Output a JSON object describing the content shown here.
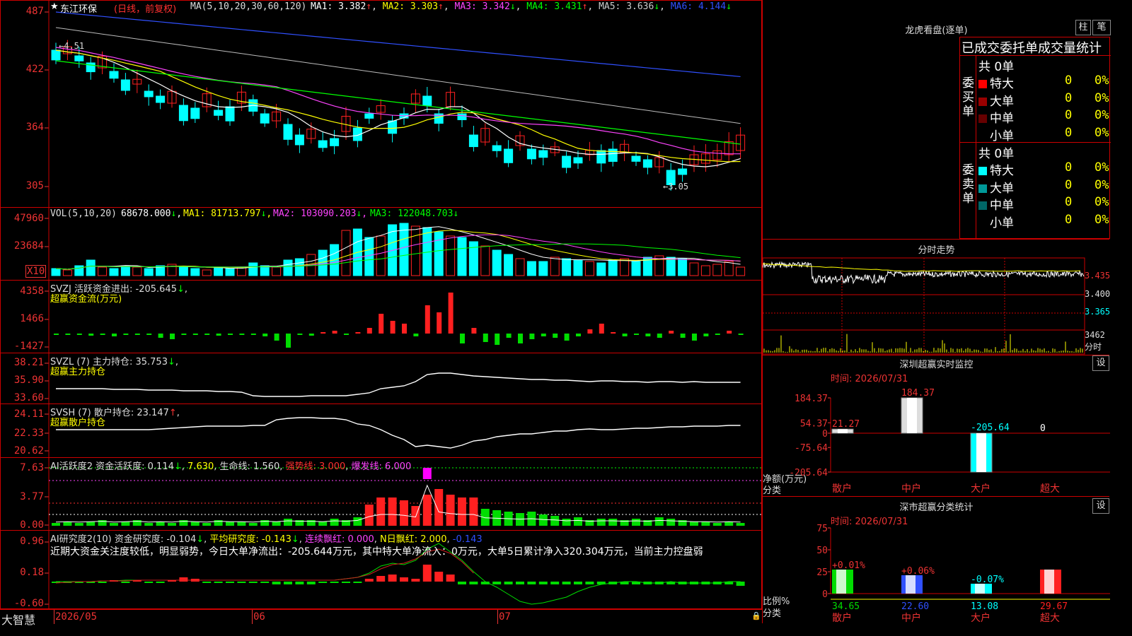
{
  "stock": {
    "name": "东江环保",
    "period": "(日线，前复权)",
    "star": "★"
  },
  "kline": {
    "axis": [
      "487",
      "422",
      "364",
      "305"
    ],
    "ma_title": "MA(5,10,20,30,60,120)",
    "ma": [
      {
        "label": "MA1: 3.382",
        "arrow": "↑",
        "color": "#ffffff"
      },
      {
        "label": "MA2: 3.303",
        "arrow": "↑",
        "color": "#ffff00"
      },
      {
        "label": "MA3: 3.342",
        "arrow": "↓",
        "color": "#ff44ff"
      },
      {
        "label": "MA4: 3.431",
        "arrow": "↑",
        "color": "#00ff00"
      },
      {
        "label": "MA5: 3.636",
        "arrow": "↓",
        "color": "#cccccc"
      },
      {
        "label": "MA6: 4.144",
        "arrow": "↓",
        "color": "#3050ff"
      }
    ],
    "high_label": "4.51",
    "low_label": "3.05"
  },
  "vol": {
    "axis": [
      "47960",
      "23684",
      "X10"
    ],
    "title": "VOL(5,10,20)",
    "value": "68678.000",
    "arrow": "↓",
    "ma1": "MA1: 81713.797",
    "ma2": "MA2: 103090.203",
    "ma3": "MA3: 122048.703"
  },
  "svzj": {
    "axis": [
      "4358",
      "1466",
      "-1427"
    ],
    "title": "SVZJ  活跃资金进出: -205.645",
    "arrow": "↓",
    "sub": "超赢资金流(万元)"
  },
  "svzl": {
    "axis": [
      "38.21",
      "35.90",
      "33.60"
    ],
    "title": "SVZL (7) 主力持仓: 35.753",
    "arrow": "↓",
    "sub": "超赢主力持仓"
  },
  "svsh": {
    "axis": [
      "24.11",
      "22.33",
      "20.62"
    ],
    "title": "SVSH (7) 散户持仓: 23.147",
    "arrow": "↑",
    "sub": "超赢散户持仓"
  },
  "ai1": {
    "axis": [
      "7.63",
      "3.77",
      "0.00"
    ],
    "name": "AI活跃度2",
    "a": "资金活跃度: 0.114",
    "a_arrow": "↓",
    "b": "7.630",
    "c": "生命线: 1.560",
    "d": "强势线: 3.000",
    "e": "爆发线: 6.000"
  },
  "ai2": {
    "axis": [
      "0.96",
      "0.18",
      "-0.60"
    ],
    "name": "AI研究度2(10)",
    "a": "资金研究度: -0.104",
    "b": "平均研究度: -0.143",
    "c": "连续飘红: 0.000",
    "d": "N日飘红: 2.000",
    "e": "-0.143",
    "comment": "近期大资金关注度较低，明显弱势，今日大单净流出：-205.644万元，其中特大单净流入：0万元，大单5日累计净入320.304万元，当前主力控盘弱"
  },
  "dates": {
    "brand": "大智慧",
    "d1": "2026/05",
    "d2": "06",
    "d3": "07"
  },
  "longhu": {
    "title": "龙虎看盘(逐单)",
    "btn1": "柱",
    "btn2": "笔",
    "header": "已成交委托单成交量统计",
    "buy": {
      "side": "委买单",
      "total": "共 0单",
      "rows": [
        {
          "name": "特大",
          "v": "0",
          "p": "0%",
          "color": "#ff0000"
        },
        {
          "name": "大单",
          "v": "0",
          "p": "0%",
          "color": "#990000"
        },
        {
          "name": "中单",
          "v": "0",
          "p": "0%",
          "color": "#660000"
        },
        {
          "name": "小单",
          "v": "0",
          "p": "0%",
          "color": "#000000"
        }
      ]
    },
    "sell": {
      "side": "委卖单",
      "total": "共 0单",
      "rows": [
        {
          "name": "特大",
          "v": "0",
          "p": "0%",
          "color": "#00ffff"
        },
        {
          "name": "大单",
          "v": "0",
          "p": "0%",
          "color": "#009999"
        },
        {
          "name": "中单",
          "v": "0",
          "p": "0%",
          "color": "#006666"
        },
        {
          "name": "小单",
          "v": "0",
          "p": "0%",
          "color": "#000000"
        }
      ]
    }
  },
  "fenshi": {
    "title": "分时走势",
    "axis": [
      "3.435",
      "3.400",
      "3.365"
    ],
    "vol": "3462",
    "vol_unit": "分时"
  },
  "monitor": {
    "title": "深圳超赢实时监控",
    "btn": "设",
    "time": "时间: 2026/07/31",
    "axis": [
      "184.37",
      "54.37",
      "0",
      "-75.64",
      "-205.64"
    ],
    "ylabel": "净额(万元)",
    "xlabel": "分类",
    "bars": [
      {
        "cat": "散户",
        "v": "21.27"
      },
      {
        "cat": "中户",
        "v": "184.37"
      },
      {
        "cat": "大户",
        "v": "-205.64"
      },
      {
        "cat": "超大",
        "v": "0"
      }
    ]
  },
  "classify": {
    "title": "深市超赢分类统计",
    "btn": "设",
    "time": "时间: 2026/07/31",
    "axis": [
      "75",
      "50",
      "25",
      "0"
    ],
    "ylabel": "比例%",
    "xlabel": "分类",
    "bars": [
      {
        "cat": "散户",
        "v": "34.65",
        "d": "+0.01%"
      },
      {
        "cat": "中户",
        "v": "22.60",
        "d": "+0.06%"
      },
      {
        "cat": "大户",
        "v": "13.08",
        "d": "-0.07%"
      },
      {
        "cat": "超大",
        "v": "29.67",
        "d": ""
      }
    ]
  }
}
